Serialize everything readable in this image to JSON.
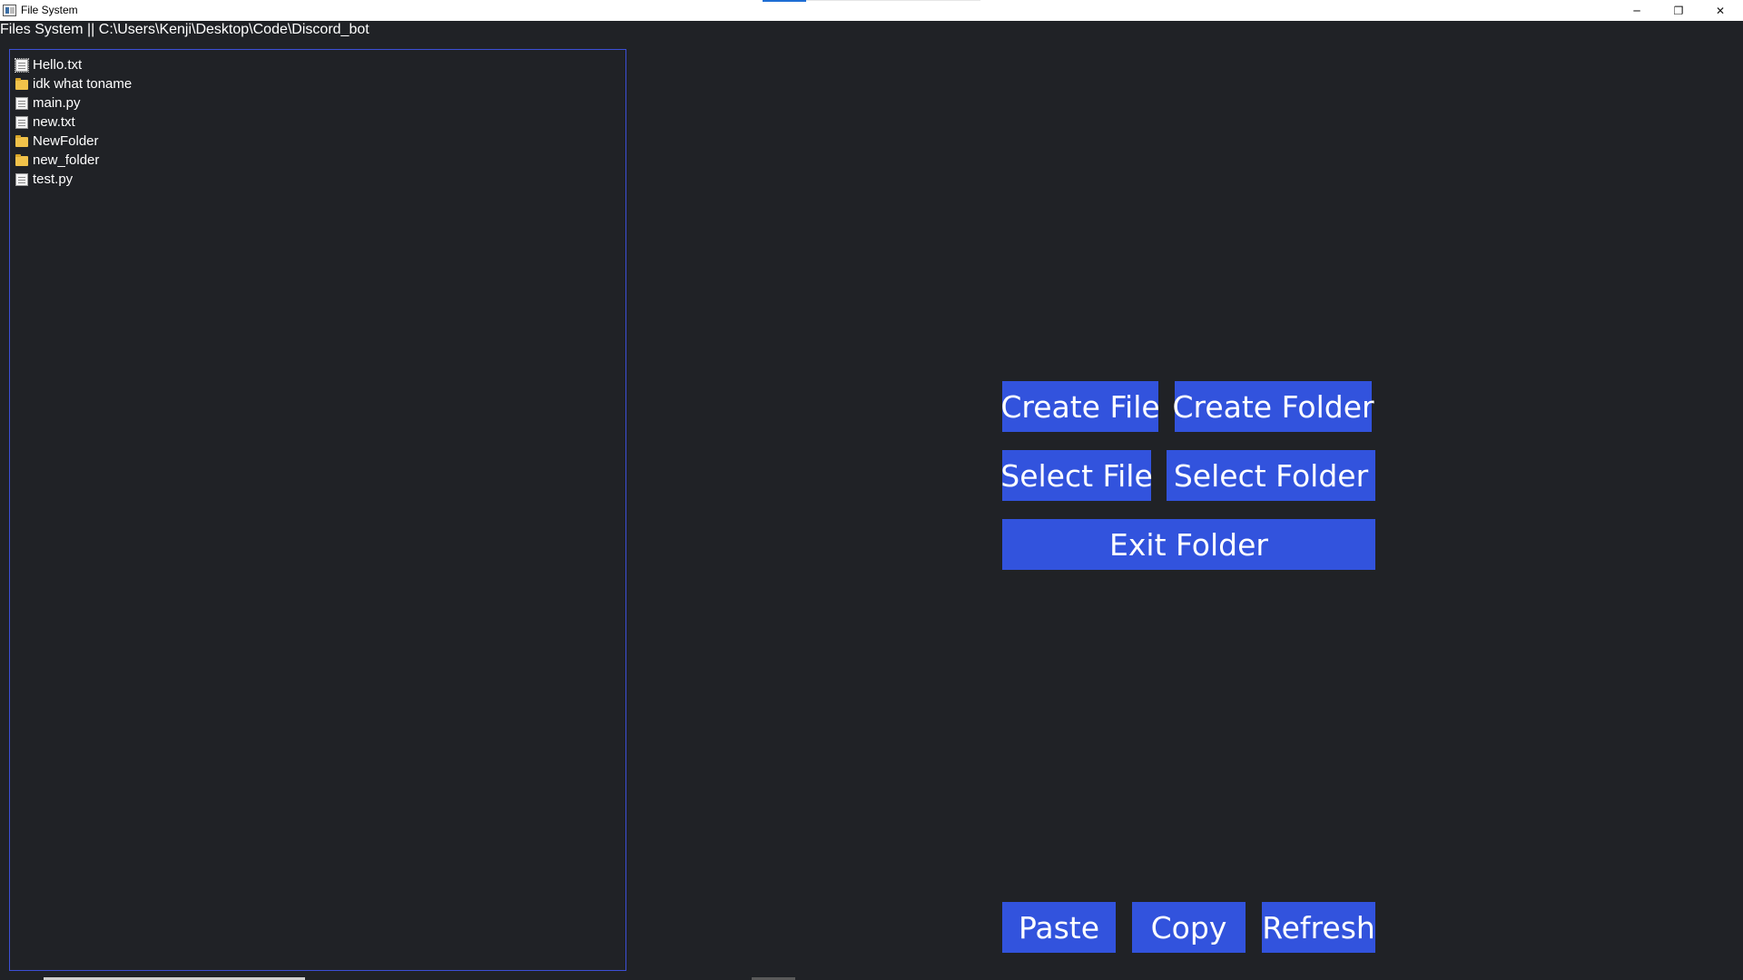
{
  "window": {
    "title": "File System",
    "minimize_glyph": "─",
    "maximize_glyph": "❐",
    "close_glyph": "✕"
  },
  "path_bar": {
    "text": "Files System  || C:\\Users\\Kenji\\Desktop\\Code\\Discord_bot"
  },
  "tree": {
    "items": [
      {
        "label": "Hello.txt",
        "icon": "file-icon"
      },
      {
        "label": "idk what toname",
        "icon": "folder-icon"
      },
      {
        "label": "main.py",
        "icon": "file-icon"
      },
      {
        "label": "new.txt",
        "icon": "file-icon"
      },
      {
        "label": "NewFolder",
        "icon": "folder-icon"
      },
      {
        "label": "new_folder",
        "icon": "folder-icon"
      },
      {
        "label": "test.py",
        "icon": "file-icon"
      }
    ]
  },
  "actions": {
    "create_file": "Create File",
    "create_folder": "Create Folder",
    "select_file": "Select File",
    "select_folder": "Select Folder",
    "exit_folder": "Exit Folder",
    "paste": "Paste",
    "copy": "Copy",
    "refresh": "Refresh"
  },
  "colors": {
    "background": "#202226",
    "button": "#3253dd",
    "tree_border": "#3c4fd6",
    "text": "#ffffff"
  }
}
